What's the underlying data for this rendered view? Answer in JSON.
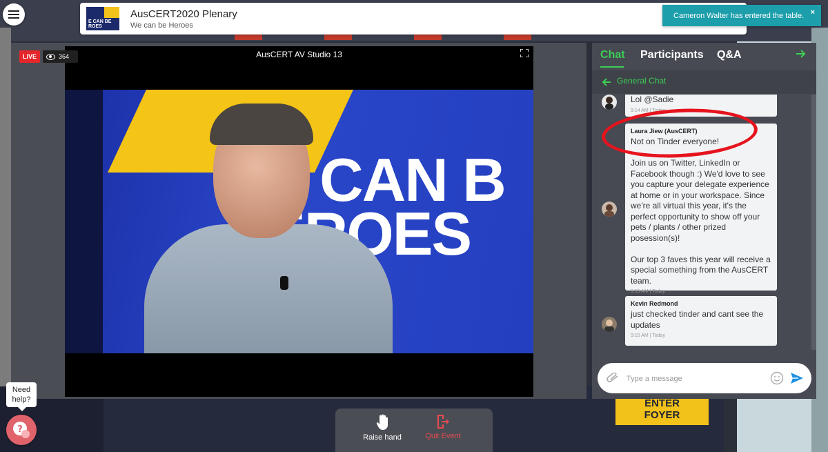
{
  "header": {
    "event_title": "AusCERT2020 Plenary",
    "event_subtitle": "We can be Heroes",
    "thumb_text": "E CAN BE\nROES"
  },
  "toast": {
    "message": "Cameron Walter has entered the table.",
    "close": "×"
  },
  "player": {
    "live": "LIVE",
    "viewers": "364",
    "stream_title": "AusCERT AV Studio 13",
    "backdrop_text_line1": "E CAN B",
    "backdrop_text_line2": "EROES"
  },
  "controls": {
    "raise_hand": "Raise hand",
    "quit_event": "Quit Event"
  },
  "help": {
    "label_line1": "Need",
    "label_line2": "help?"
  },
  "scenery": {
    "sign_line1": "ENTER",
    "sign_line2": "FOYER"
  },
  "chat": {
    "tabs": [
      "Chat",
      "Participants",
      "Q&A"
    ],
    "active_tab": "Chat",
    "channel": "General Chat",
    "messages": [
      {
        "author": "",
        "body": "Lol @Sadie",
        "time": "9:14 AM | Today"
      },
      {
        "author": "Laura Jiew (AusCERT)",
        "body": "Not on Tinder everyone!\n\nJoin us on Twitter, LinkedIn or Facebook though :) We'd love to see you capture your delegate experience at home or in your workspace. Since we're all virtual this year, it's the perfect opportunity to show off your pets / plants / other prized posession(s)!\n\nOur top 3 faves this year will receive a special something from the AusCERT team.",
        "time": "9:15 AM | Today"
      },
      {
        "author": "Kevin Redmond",
        "body": "just checked tinder and cant see the updates",
        "time": "9:15 AM | Today"
      }
    ],
    "input_placeholder": "Type a message"
  },
  "colors": {
    "accent_green": "#3ccf55",
    "live_red": "#e5262b",
    "toast_teal": "#1c9eab",
    "annotation_red": "#e6131d"
  }
}
